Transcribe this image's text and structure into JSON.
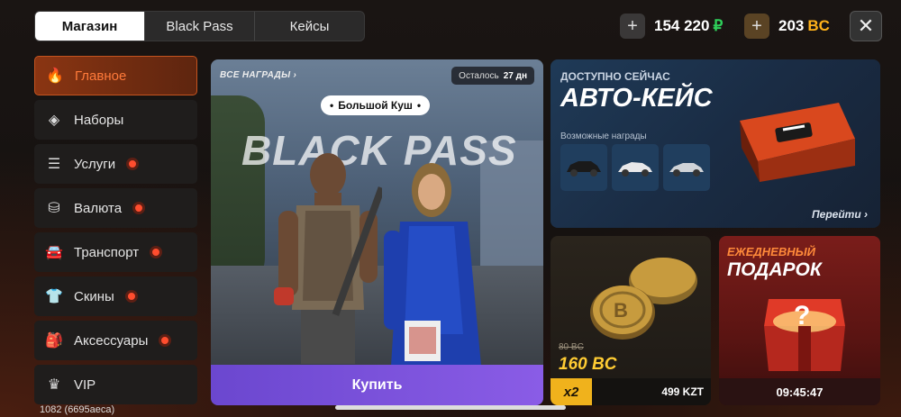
{
  "tabs": [
    {
      "label": "Магазин",
      "active": true
    },
    {
      "label": "Black Pass",
      "active": false
    },
    {
      "label": "Кейсы",
      "active": false
    }
  ],
  "balance": {
    "rub": {
      "amount": "154 220",
      "unit": "₽"
    },
    "bc": {
      "amount": "203",
      "unit": "BC"
    }
  },
  "sidebar": {
    "items": [
      {
        "label": "Главное",
        "icon": "flame-icon",
        "glyph": "🔥",
        "active": true,
        "badge": false
      },
      {
        "label": "Наборы",
        "icon": "stack-icon",
        "glyph": "◈",
        "active": false,
        "badge": false
      },
      {
        "label": "Услуги",
        "icon": "list-icon",
        "glyph": "☰",
        "active": false,
        "badge": true
      },
      {
        "label": "Валюта",
        "icon": "coins-icon",
        "glyph": "⛁",
        "active": false,
        "badge": true
      },
      {
        "label": "Транспорт",
        "icon": "car-icon",
        "glyph": "🚘",
        "active": false,
        "badge": true
      },
      {
        "label": "Скины",
        "icon": "shirt-icon",
        "glyph": "👕",
        "active": false,
        "badge": true
      },
      {
        "label": "Аксессуары",
        "icon": "backpack-icon",
        "glyph": "🎒",
        "active": false,
        "badge": true
      },
      {
        "label": "VIP",
        "icon": "crown-icon",
        "glyph": "♛",
        "active": false,
        "badge": false
      }
    ]
  },
  "footnote": "1082 (6695aeca)",
  "black_pass": {
    "all_rewards": "ВСЕ НАГРАДЫ",
    "left_label": "Осталось",
    "left_value": "27 дн",
    "pill": "Большой Куш",
    "title": "BLACK PASS",
    "buy": "Купить"
  },
  "auto_case": {
    "subtitle": "ДОСТУПНО СЕЙЧАС",
    "title": "АВТО-КЕЙС",
    "rewards_label": "Возможные награды",
    "link": "Перейти"
  },
  "coins_offer": {
    "old_price": "80 BC",
    "new_amount": "160 BC",
    "multiplier": "x2",
    "price": "499 KZT"
  },
  "daily": {
    "line1": "ЕЖЕДНЕВНЫЙ",
    "line2": "ПОДАРОК",
    "timer": "09:45:47"
  },
  "colors": {
    "accent_orange": "#ff6a2a",
    "rub_green": "#2fd05a",
    "bc_gold": "#ffb21a",
    "buy_purple": "#7b52db"
  }
}
